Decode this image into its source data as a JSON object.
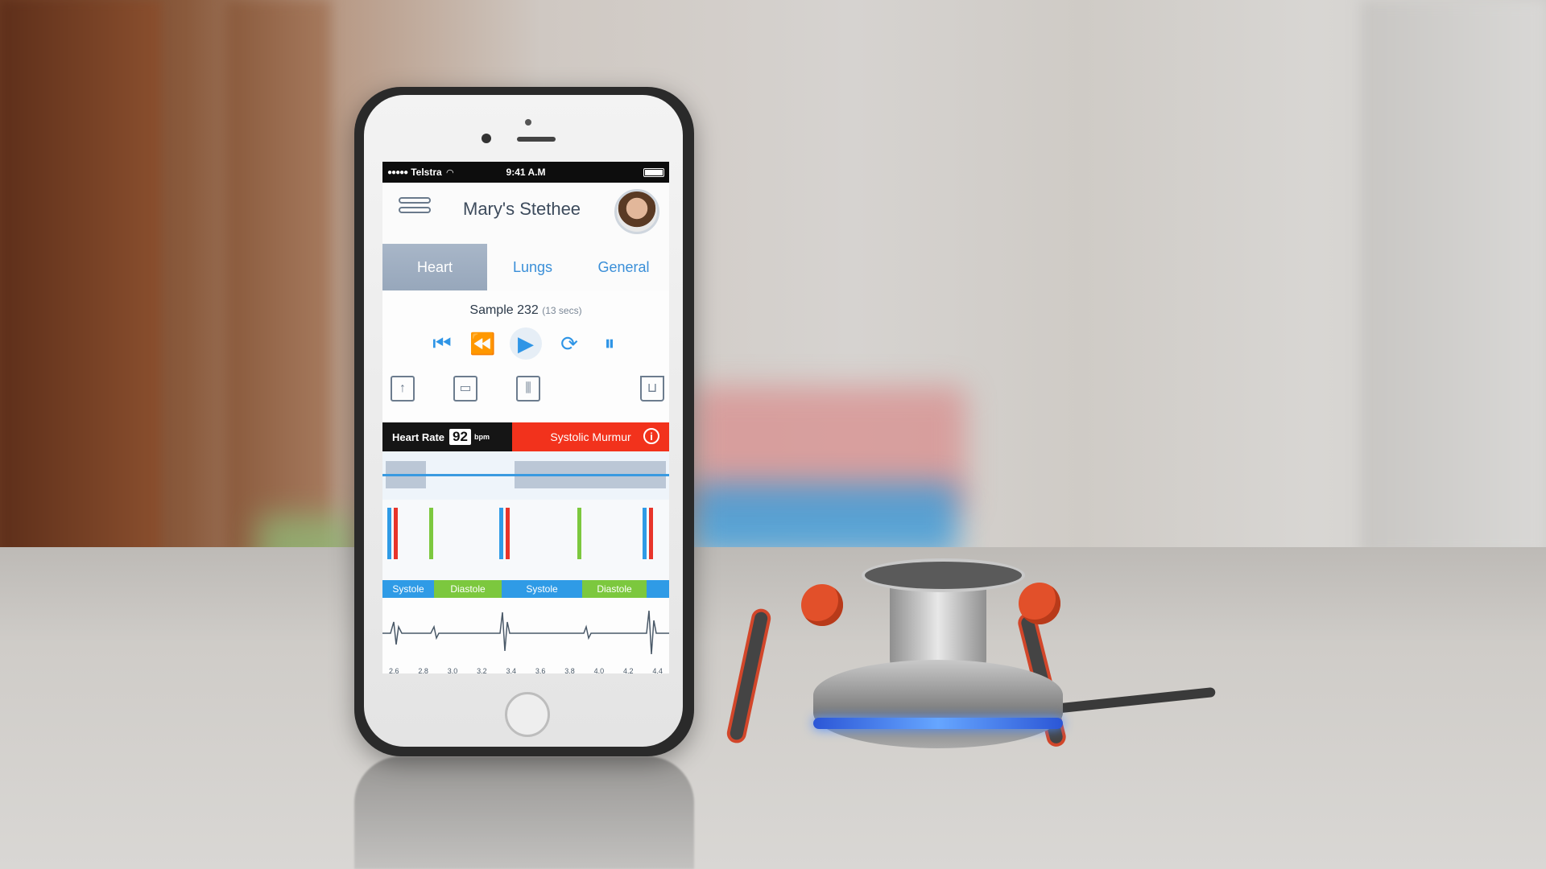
{
  "status_bar": {
    "signal_dots": "●●●●●",
    "carrier": "Telstra",
    "wifi_icon": "wifi-icon",
    "time": "9:41 A.M"
  },
  "header": {
    "title": "Mary's Stethee",
    "menu_icon": "menu-icon",
    "avatar": "profile-avatar"
  },
  "tabs": [
    {
      "label": "Heart",
      "active": true
    },
    {
      "label": "Lungs",
      "active": false
    },
    {
      "label": "General",
      "active": false
    }
  ],
  "sample": {
    "label": "Sample 232",
    "duration": "(13 secs)"
  },
  "transport": {
    "skip_back": "⏮",
    "rewind": "⏪",
    "play": "▶",
    "loop": "⟳",
    "pause": "⏸"
  },
  "tools": {
    "share_icon": "share-icon",
    "save_icon": "save-icon",
    "equalizer_icon": "equalizer-icon",
    "trash_icon": "trash-icon"
  },
  "heart_rate": {
    "label": "Heart Rate",
    "value": "92",
    "unit": "bpm"
  },
  "diagnosis": {
    "label": "Systolic Murmur",
    "info": "i"
  },
  "phases": [
    {
      "label": "Systole",
      "color": "#2f9be6"
    },
    {
      "label": "Diastole",
      "color": "#7cc83e"
    },
    {
      "label": "Systole",
      "color": "#2f9be6"
    },
    {
      "label": "Diastole",
      "color": "#7cc83e"
    }
  ],
  "axis_ticks": [
    "2.6",
    "2.8",
    "3.0",
    "3.2",
    "3.4",
    "3.6",
    "3.8",
    "4.0",
    "4.2",
    "4.4"
  ],
  "colors": {
    "accent": "#2f95e6",
    "alert": "#f2321c",
    "s1_marker": "#e8342a",
    "s2_marker": "#7cc83e",
    "glow": "#4c8cff"
  }
}
